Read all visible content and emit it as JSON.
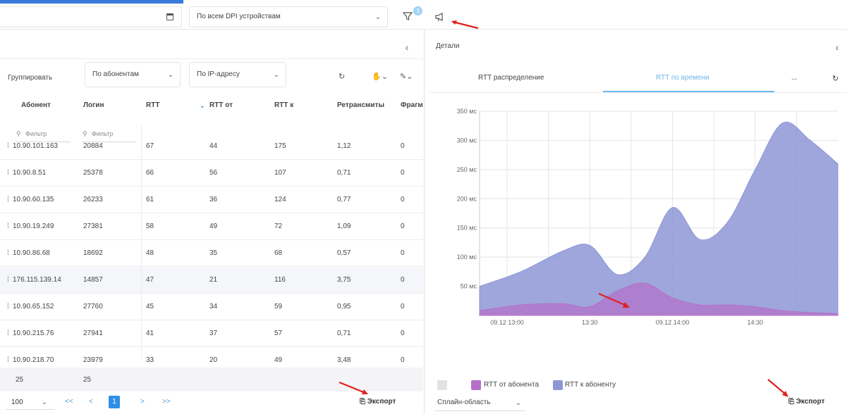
{
  "toolbar": {
    "dpi_select": "По всем DPI устройствам",
    "filter_badge": "3"
  },
  "left": {
    "group_label": "Группировать",
    "group_by_subscriber": "По абонентам",
    "group_by_ip": "По IP-адресу",
    "columns": [
      "Абонент",
      "Логин",
      "RTT",
      "RTT от",
      "RTT к",
      "Ретрансмиты",
      "Фрагм"
    ],
    "filter_placeholder_1": "Фильтр",
    "filter_placeholder_2": "Фильтр",
    "rows": [
      {
        "ip": "10.90.101.163",
        "login": "20884",
        "rtt": "67",
        "rtt_from": "44",
        "rtt_to": "175",
        "retrans": "1,12",
        "frag": "0"
      },
      {
        "ip": "10.90.8.51",
        "login": "25378",
        "rtt": "66",
        "rtt_from": "56",
        "rtt_to": "107",
        "retrans": "0,71",
        "frag": "0"
      },
      {
        "ip": "10.90.60.135",
        "login": "26233",
        "rtt": "61",
        "rtt_from": "36",
        "rtt_to": "124",
        "retrans": "0,77",
        "frag": "0"
      },
      {
        "ip": "10.90.19.249",
        "login": "27381",
        "rtt": "58",
        "rtt_from": "49",
        "rtt_to": "72",
        "retrans": "1,09",
        "frag": "0"
      },
      {
        "ip": "10.90.86.68",
        "login": "18692",
        "rtt": "48",
        "rtt_from": "35",
        "rtt_to": "68",
        "retrans": "0,57",
        "frag": "0"
      },
      {
        "ip": "176.115.139.14",
        "login": "14857",
        "rtt": "47",
        "rtt_from": "21",
        "rtt_to": "116",
        "retrans": "3,75",
        "frag": "0"
      },
      {
        "ip": "10.90.65.152",
        "login": "27760",
        "rtt": "45",
        "rtt_from": "34",
        "rtt_to": "59",
        "retrans": "0,95",
        "frag": "0"
      },
      {
        "ip": "10.90.215.76",
        "login": "27941",
        "rtt": "41",
        "rtt_from": "37",
        "rtt_to": "57",
        "retrans": "0,71",
        "frag": "0"
      },
      {
        "ip": "10.90.218.70",
        "login": "23979",
        "rtt": "33",
        "rtt_from": "20",
        "rtt_to": "49",
        "retrans": "3,48",
        "frag": "0"
      }
    ],
    "totals": {
      "subscribers": "25",
      "logins": "25"
    },
    "pager": {
      "page_size": "100",
      "first": "<<",
      "prev": "<",
      "current": "1",
      "next": ">",
      "last": ">>"
    },
    "export_label": "Экспорт"
  },
  "right": {
    "title": "Детали",
    "tabs": [
      "RTT распределение",
      "RTT по времени",
      "..."
    ],
    "active_tab": 1,
    "legend": [
      "RTT от абонента",
      "RTT к абоненту"
    ],
    "chart_type_select": "Сплайн-область",
    "export_label": "Экспорт"
  },
  "colors": {
    "accent": "#2e8fe6",
    "tab_active": "#6cb8ec",
    "series_from": "#b56fc8",
    "series_to": "#8d97d6"
  },
  "chart_data": {
    "type": "area",
    "x_tick_labels": [
      "09.12 13:00",
      "13:30",
      "09.12 14:00",
      "14:30"
    ],
    "y_tick_labels": [
      "50 мс",
      "100 мс",
      "150 мс",
      "200 мс",
      "250 мс",
      "300 мс",
      "350 мс"
    ],
    "ylim": [
      0,
      350
    ],
    "x": [
      "12:50",
      "13:05",
      "13:20",
      "13:30",
      "13:40",
      "13:50",
      "14:00",
      "14:10",
      "14:20",
      "14:30",
      "14:40",
      "14:50",
      "15:00"
    ],
    "series": [
      {
        "name": "RTT к абоненту",
        "values": [
          50,
          75,
          110,
          120,
          70,
          100,
          185,
          130,
          160,
          250,
          330,
          300,
          260
        ]
      },
      {
        "name": "RTT от абонента",
        "values": [
          8,
          18,
          20,
          15,
          42,
          55,
          30,
          18,
          18,
          15,
          8,
          5,
          3
        ]
      }
    ],
    "grid": true,
    "legend_position": "bottom-left"
  }
}
